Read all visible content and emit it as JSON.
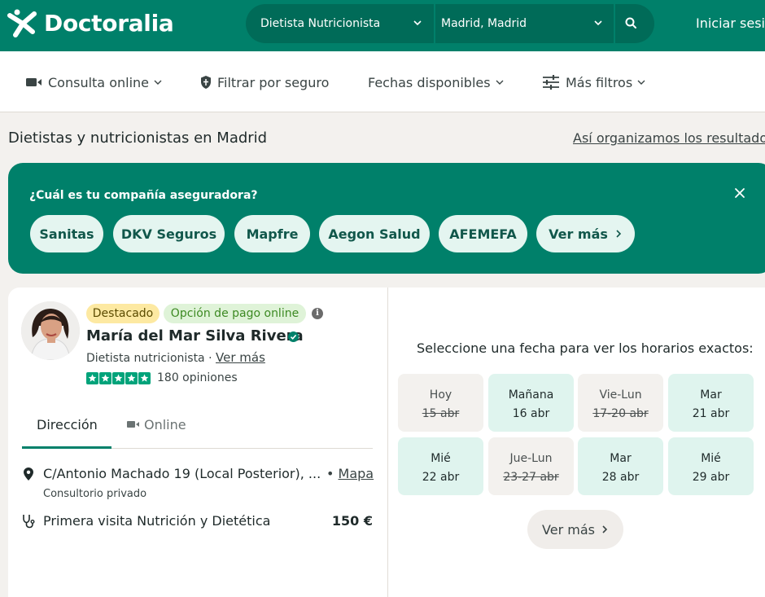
{
  "header": {
    "brand": "Doctoralia",
    "specialty": "Dietista Nutricionista",
    "location": "Madrid, Madrid",
    "login": "Iniciar sesió"
  },
  "filters": {
    "online": "Consulta online",
    "insurance": "Filtrar por seguro",
    "dates": "Fechas disponibles",
    "more": "Más filtros"
  },
  "results": {
    "title": "Dietistas y nutricionistas en Madrid",
    "how": "Así organizamos los resultados"
  },
  "insurance": {
    "question": "¿Cuál es tu compañía aseguradora?",
    "options": [
      "Sanitas",
      "DKV Seguros",
      "Mapfre",
      "Aegon Salud",
      "AFEMEFA",
      "Ver más"
    ]
  },
  "doctor": {
    "badge_featured": "Destacado",
    "badge_payment": "Opción de pago online",
    "name": "María del Mar Silva Rivera",
    "specialty": "Dietista nutricionista",
    "specialty_more": "Ver más",
    "rating": 5,
    "reviews": "180 opiniones",
    "tabs": {
      "address": "Dirección",
      "online": "Online"
    },
    "address": "C/Antonio Machado 19 (Local Posterior), ...",
    "map": "Mapa",
    "clinic_type": "Consultorio privado",
    "visit": "Primera visita Nutrición y Dietética",
    "price": "150 €"
  },
  "calendar": {
    "title": "Seleccione una fecha para ver los horarios exactos:",
    "days": [
      {
        "d1": "Hoy",
        "d2": "15 abr",
        "available": false
      },
      {
        "d1": "Mañana",
        "d2": "16 abr",
        "available": true
      },
      {
        "d1": "Vie-Lun",
        "d2": "17-20 abr",
        "available": false
      },
      {
        "d1": "Mar",
        "d2": "21 abr",
        "available": true
      },
      {
        "d1": "Mié",
        "d2": "22 abr",
        "available": true
      },
      {
        "d1": "Jue-Lun",
        "d2": "23-27 abr",
        "available": false
      },
      {
        "d1": "Mar",
        "d2": "28 abr",
        "available": true
      },
      {
        "d1": "Mié",
        "d2": "29 abr",
        "available": true
      }
    ],
    "more": "Ver más"
  },
  "colors": {
    "brand": "#00806a",
    "chip_bg": "#e4f5f0",
    "available_bg": "#dff4ee",
    "star": "#00a37a"
  }
}
